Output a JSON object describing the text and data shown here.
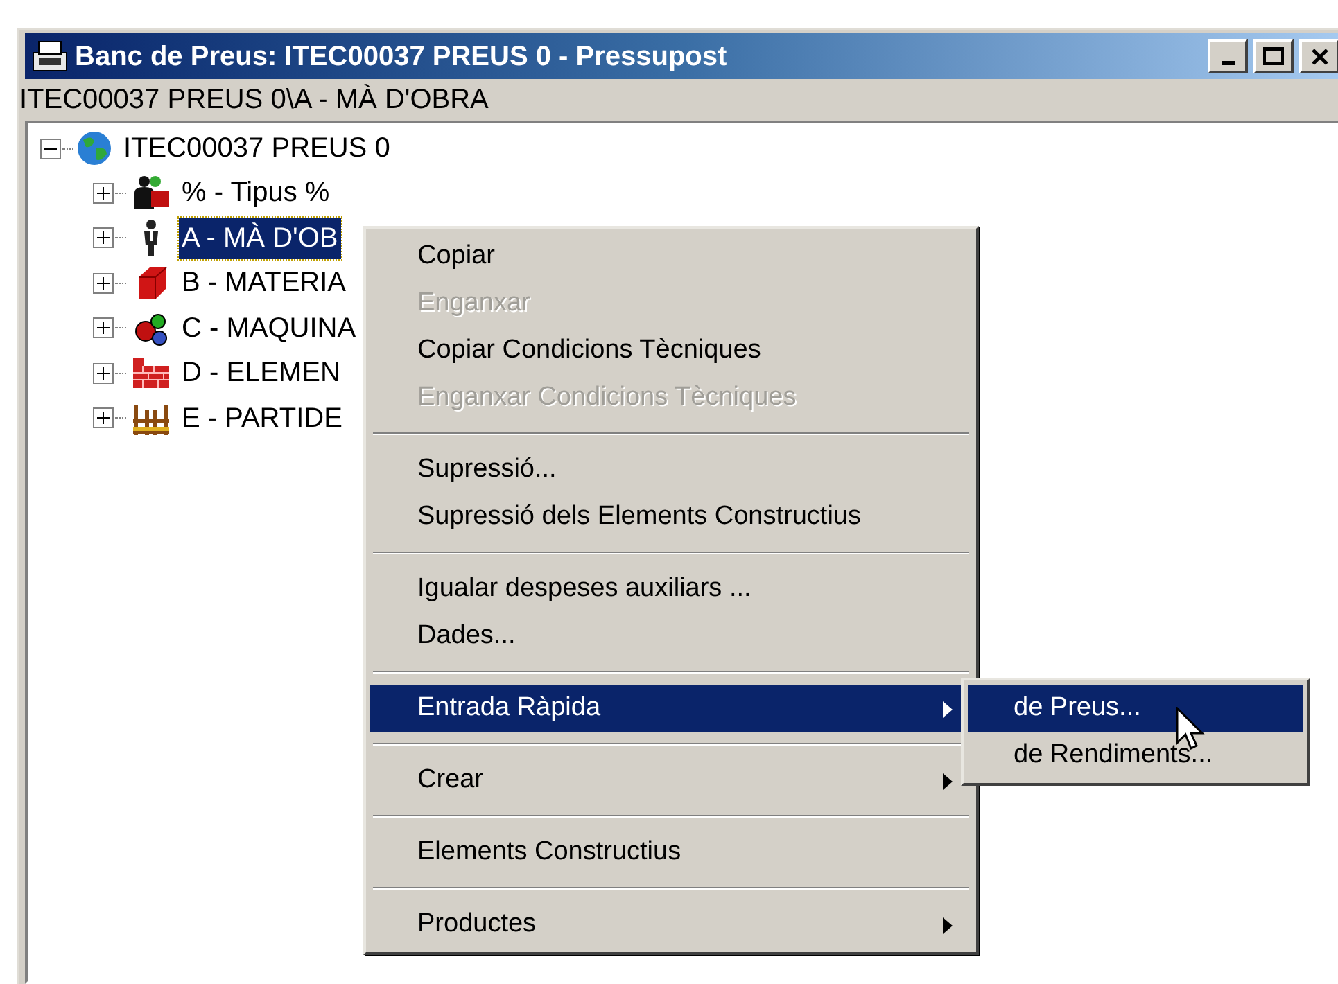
{
  "window": {
    "title": "Banc de Preus: ITEC00037 PREUS 0 - Pressupost"
  },
  "path_bar": "ITEC00037 PREUS 0\\A - MÀ D'OBRA",
  "tree": {
    "label": "ITEC00037 PREUS 0",
    "expanded": true,
    "children": [
      {
        "label": "% - Tipus %",
        "expanded": false,
        "selected": false
      },
      {
        "label": "A - MÀ D'OB",
        "expanded": false,
        "selected": true
      },
      {
        "label": "B - MATERIA",
        "expanded": false,
        "selected": false
      },
      {
        "label": "C - MAQUINA",
        "expanded": false,
        "selected": false
      },
      {
        "label": "D - ELEMEN",
        "expanded": false,
        "selected": false
      },
      {
        "label": "E - PARTIDE",
        "expanded": false,
        "selected": false
      }
    ]
  },
  "context_menu": [
    {
      "kind": "item",
      "label": "Copiar",
      "disabled": false,
      "selected": false,
      "submenu": false
    },
    {
      "kind": "item",
      "label": "Enganxar",
      "disabled": true,
      "selected": false,
      "submenu": false
    },
    {
      "kind": "item",
      "label": "Copiar Condicions Tècniques",
      "disabled": false,
      "selected": false,
      "submenu": false
    },
    {
      "kind": "item",
      "label": "Enganxar Condicions Tècniques",
      "disabled": true,
      "selected": false,
      "submenu": false
    },
    {
      "kind": "separator"
    },
    {
      "kind": "item",
      "label": "Supressió...",
      "disabled": false,
      "selected": false,
      "submenu": false
    },
    {
      "kind": "item",
      "label": "Supressió dels Elements Constructius",
      "disabled": false,
      "selected": false,
      "submenu": false
    },
    {
      "kind": "separator"
    },
    {
      "kind": "item",
      "label": "Igualar despeses auxiliars ...",
      "disabled": false,
      "selected": false,
      "submenu": false
    },
    {
      "kind": "item",
      "label": "Dades...",
      "disabled": false,
      "selected": false,
      "submenu": false
    },
    {
      "kind": "separator"
    },
    {
      "kind": "item",
      "label": "Entrada Ràpida",
      "disabled": false,
      "selected": true,
      "submenu": true
    },
    {
      "kind": "separator"
    },
    {
      "kind": "item",
      "label": "Crear",
      "disabled": false,
      "selected": false,
      "submenu": true
    },
    {
      "kind": "separator"
    },
    {
      "kind": "item",
      "label": "Elements Constructius",
      "disabled": false,
      "selected": false,
      "submenu": false
    },
    {
      "kind": "separator"
    },
    {
      "kind": "item",
      "label": "Productes",
      "disabled": false,
      "selected": false,
      "submenu": true
    }
  ],
  "submenu": [
    {
      "label": "de Preus...",
      "selected": true
    },
    {
      "label": "de Rendiments...",
      "selected": false
    }
  ]
}
